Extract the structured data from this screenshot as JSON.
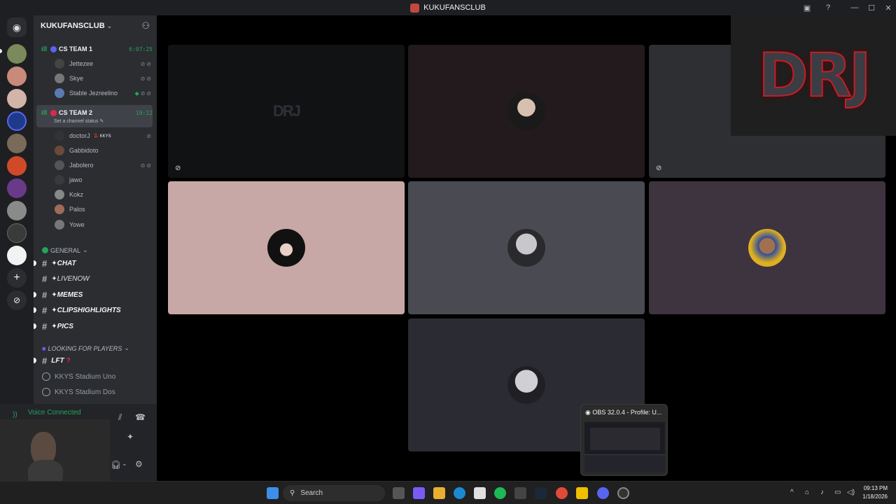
{
  "window": {
    "title": "KUKUFANSCLUB"
  },
  "server": {
    "name": "KUKUFANSCLUB"
  },
  "voice_channels": [
    {
      "name": "CS TEAM 1",
      "timer": "6:07:25",
      "members": [
        "Jettezee",
        "Skye",
        "Stable Jezreelino"
      ]
    },
    {
      "name": "CS TEAM 2",
      "timer": "19:12",
      "status": "Set a channel status",
      "members": [
        "doctorJ",
        "Gabbidoto",
        "Jabolero",
        "jawo",
        "Kokz",
        "Palos",
        "Yowe"
      ],
      "member_tag": "KKYS"
    }
  ],
  "categories": {
    "general": "GENERAL",
    "looking": "LOOKING FOR PLAYERS"
  },
  "text_channels": [
    "✦CHAT",
    "✦LIVENOW",
    "✦MEMES",
    "✦CLIPSHIGHLIGHTS",
    "✦PICS"
  ],
  "lft_channel": "LFT",
  "stage_channels": [
    "KKYS Stadium Uno",
    "KKYS Stadium Dos"
  ],
  "user_panel": {
    "voice_status": "Voice Connected"
  },
  "overlay": {
    "logo_text": "DRJ"
  },
  "tiles": [
    {
      "label": "DRJ"
    }
  ],
  "obs_preview": {
    "title": "OBS 32.0.4 - Profile: U..."
  },
  "taskbar": {
    "search_placeholder": "Search",
    "time": "09:13 PM",
    "date": "1/18/2026"
  },
  "colors": {
    "accent": "#5865f2",
    "voice_green": "#23a55a",
    "tile_pink": "#c8a8a6",
    "tile_gray": "#4a4b52",
    "tile_plum": "#3e3440"
  }
}
